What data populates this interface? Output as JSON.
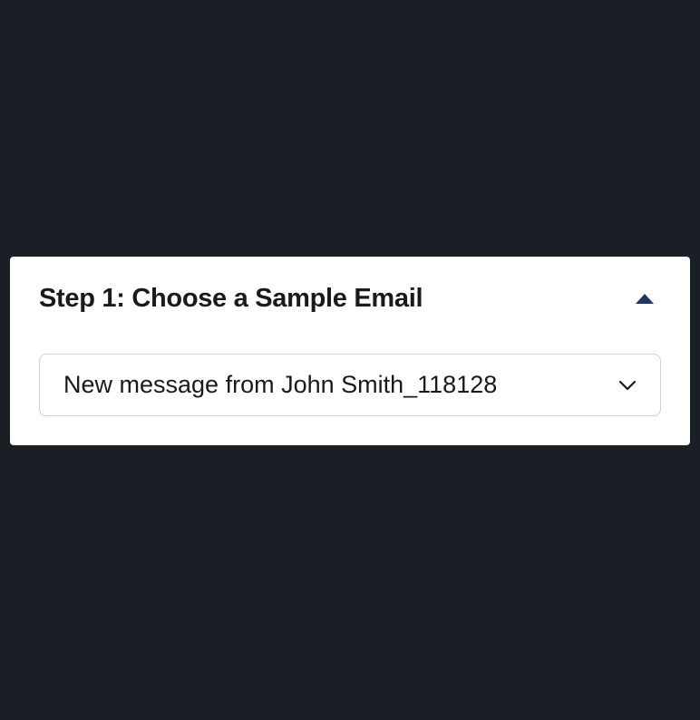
{
  "panel": {
    "title": "Step 1: Choose a Sample Email"
  },
  "dropdown": {
    "selected": "New message from John Smith_118128"
  },
  "colors": {
    "accent": "#203860",
    "background": "#1a1f26",
    "card": "#ffffff"
  }
}
